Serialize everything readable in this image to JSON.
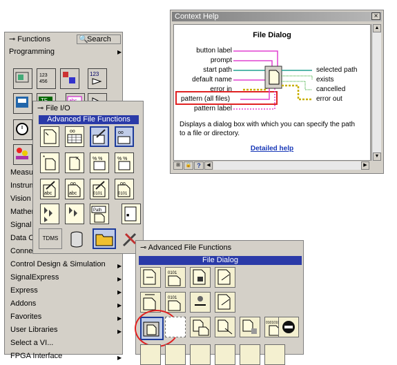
{
  "functions_palette": {
    "title": "Functions",
    "search_label": "Search",
    "programming": "Programming",
    "categories": [
      "Measu",
      "Instrum",
      "Vision",
      "Mather",
      "Signal",
      "Data C",
      "Conne",
      "Control Design & Simulation",
      "SignalExpress",
      "Express",
      "Addons",
      "Favorites",
      "User Libraries",
      "Select a VI...",
      "FPGA Interface"
    ]
  },
  "file_io": {
    "title": "File I/O",
    "header": "Advanced File Functions",
    "icons": [
      "open-file",
      "write-spreadsheet",
      "read-spreadsheet",
      "write-measurement",
      "new-file",
      "delete-file",
      "format-into-file",
      "scan-from-file",
      "write-text",
      "read-text",
      "write-binary",
      "read-binary",
      "tdms",
      "storage",
      "advanced-folder",
      "datalog"
    ]
  },
  "advanced": {
    "title": "Advanced File Functions",
    "header": "File Dialog",
    "icons": [
      "get-file-info",
      "file-size",
      "file-permissions",
      "file-type",
      "list-folder",
      "file-dialog",
      "build-path",
      "strip-path",
      "copy",
      "move",
      "delete",
      "refnum",
      "cancel"
    ]
  },
  "context_help": {
    "title": "Context Help",
    "function_name": "File Dialog",
    "inputs": [
      "button label",
      "prompt",
      "start path",
      "default name",
      "error in",
      "pattern (all files)",
      "pattern label"
    ],
    "outputs": [
      "selected path",
      "exists",
      "cancelled",
      "error out"
    ],
    "description": "Displays a dialog box with which you can specify the path to a file or directory.",
    "detailed_help": "Detailed help",
    "close_label": "×"
  },
  "colors": {
    "title_gradient_start": "#808080",
    "selected_header": "#2a3aa8",
    "highlight_red": "#e02020",
    "wire_pink": "#e040d0",
    "wire_teal": "#20a090",
    "wire_green": "#20a020",
    "error_yellow": "#c8b000"
  }
}
